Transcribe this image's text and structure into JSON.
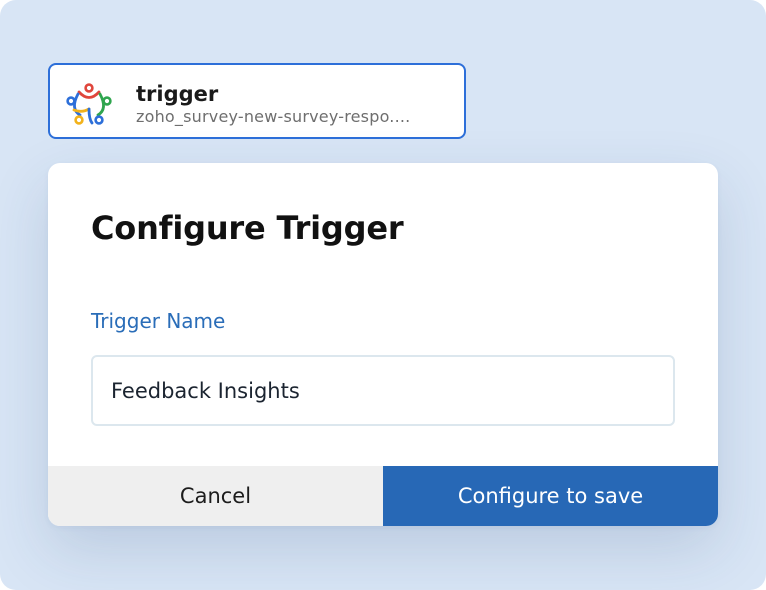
{
  "trigger_card": {
    "logo_icon": "zoho-survey-logo-icon",
    "title": "trigger",
    "subtitle": "zoho_survey-new-survey-respo...."
  },
  "modal": {
    "title": "Configure Trigger",
    "field": {
      "label": "Trigger Name",
      "value": "Feedback Insights"
    },
    "buttons": {
      "cancel_label": "Cancel",
      "save_label": "Configure to save"
    }
  },
  "colors": {
    "background": "#d8e5f5",
    "card_border": "#2d6fd9",
    "label_blue": "#2a6db8",
    "primary_button": "#2768b6",
    "cancel_button": "#efefef",
    "logo_red": "#e0463c",
    "logo_blue": "#2d6fd9",
    "logo_green": "#2fa54e",
    "logo_yellow": "#f2b21b"
  }
}
